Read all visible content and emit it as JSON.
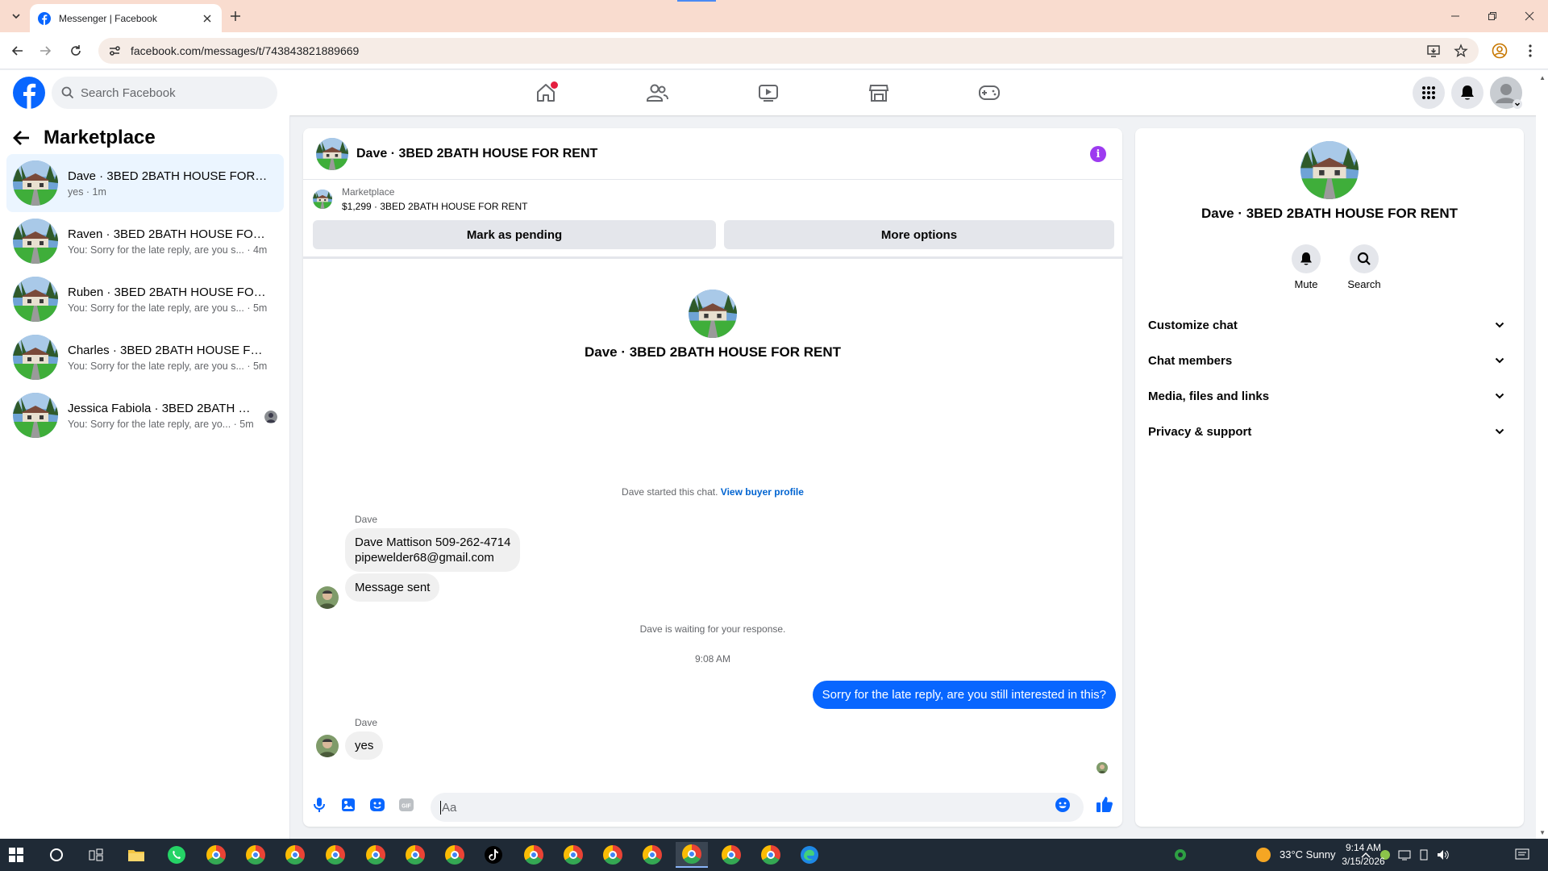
{
  "browser": {
    "tab_title": "Messenger | Facebook",
    "url": "facebook.com/messages/t/743843821889669"
  },
  "fb": {
    "search_placeholder": "Search Facebook"
  },
  "sidebar": {
    "title": "Marketplace",
    "conversations": [
      {
        "name": "Dave · 3BED 2BATH HOUSE FOR R...",
        "preview": "yes · 1m"
      },
      {
        "name": "Raven · 3BED 2BATH HOUSE FOR ...",
        "preview": "You: Sorry for the late reply, are you s... · 4m"
      },
      {
        "name": "Ruben · 3BED 2BATH HOUSE FOR ...",
        "preview": "You: Sorry for the late reply, are you s... · 5m"
      },
      {
        "name": "Charles · 3BED 2BATH HOUSE FOR...",
        "preview": "You: Sorry for the late reply, are you s... · 5m"
      },
      {
        "name": "Jessica Fabiola · 3BED 2BATH H...",
        "preview": "You: Sorry for the late reply, are yo... · 5m"
      }
    ]
  },
  "chat": {
    "header_name": "Dave · 3BED 2BATH HOUSE FOR RENT",
    "marketplace_label": "Marketplace",
    "listing": "$1,299 · 3BED 2BATH HOUSE FOR RENT",
    "mark_pending": "Mark as pending",
    "more_options": "More options",
    "hero_name": "Dave · 3BED 2BATH HOUSE FOR RENT",
    "started_text": "Dave started this chat. ",
    "view_profile": "View buyer profile",
    "sender_1": "Dave",
    "msg_1_line1": "Dave Mattison 509-262-4714",
    "msg_1_line2": "pipewelder68@gmail.com",
    "msg_2": "Message sent",
    "waiting": "Dave is waiting for your response.",
    "time": "9:08 AM",
    "msg_out": "Sorry for the late reply, are you still interested in this?",
    "sender_2": "Dave",
    "msg_3": "yes",
    "composer_placeholder": "Aa"
  },
  "right_panel": {
    "name": "Dave · 3BED 2BATH HOUSE FOR RENT",
    "mute": "Mute",
    "search": "Search",
    "rows": [
      "Customize chat",
      "Chat members",
      "Media, files and links",
      "Privacy & support"
    ]
  },
  "taskbar": {
    "weather": "33°C  Sunny",
    "time": "9:14 AM",
    "date": "3/15/2026"
  },
  "colors": {
    "brand": "#0866ff",
    "tabstrip": "#f9dccf",
    "info": "#9d3bf0"
  }
}
